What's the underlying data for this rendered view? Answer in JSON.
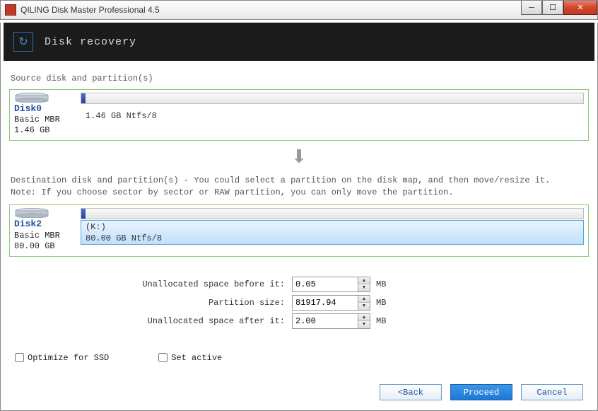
{
  "window": {
    "title": "QILING Disk Master Professional 4.5"
  },
  "header": {
    "title": "Disk recovery"
  },
  "source": {
    "section_label": "Source disk and partition(s)",
    "disk": {
      "name": "Disk0",
      "type": "Basic MBR",
      "size": "1.46 GB",
      "map_text": "1.46 GB Ntfs/8"
    }
  },
  "dest": {
    "section_label": "Destination disk and partition(s) - You could select a partition on the disk map, and then move/resize it.",
    "note": "Note: If you choose sector by sector or RAW partition, you can only move the partition.",
    "disk": {
      "name": "Disk2",
      "type": "Basic MBR",
      "size": "80.00 GB",
      "drive_letter": "(K:)",
      "map_text": "80.00 GB Ntfs/8"
    }
  },
  "form": {
    "before": {
      "label": "Unallocated space before it:",
      "value": "0.05",
      "unit": "MB"
    },
    "size": {
      "label": "Partition size:",
      "value": "81917.94",
      "unit": "MB"
    },
    "after": {
      "label": "Unallocated space after it:",
      "value": "2.00",
      "unit": "MB"
    }
  },
  "options": {
    "ssd": "Optimize for SSD",
    "active": "Set active"
  },
  "buttons": {
    "back": "<Back",
    "proceed": "Proceed",
    "cancel": "Cancel"
  }
}
